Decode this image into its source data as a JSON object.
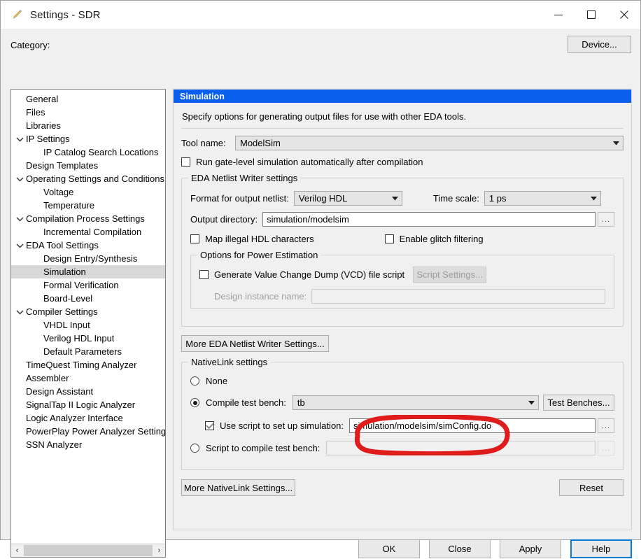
{
  "window": {
    "title": "Settings - SDR",
    "icon": "pencil-icon",
    "minimize": "minimize-icon",
    "maximize": "maximize-icon",
    "close": "close-icon"
  },
  "category": {
    "label": "Category:",
    "device_button": "Device...",
    "selected": "Simulation",
    "items": [
      {
        "label": "General",
        "indent": 0,
        "expander": ""
      },
      {
        "label": "Files",
        "indent": 0,
        "expander": ""
      },
      {
        "label": "Libraries",
        "indent": 0,
        "expander": ""
      },
      {
        "label": "IP Settings",
        "indent": 0,
        "expander": "down"
      },
      {
        "label": "IP Catalog Search Locations",
        "indent": 1,
        "expander": ""
      },
      {
        "label": "Design Templates",
        "indent": 0,
        "expander": ""
      },
      {
        "label": "Operating Settings and Conditions",
        "indent": 0,
        "expander": "down"
      },
      {
        "label": "Voltage",
        "indent": 1,
        "expander": ""
      },
      {
        "label": "Temperature",
        "indent": 1,
        "expander": ""
      },
      {
        "label": "Compilation Process Settings",
        "indent": 0,
        "expander": "down"
      },
      {
        "label": "Incremental Compilation",
        "indent": 1,
        "expander": ""
      },
      {
        "label": "EDA Tool Settings",
        "indent": 0,
        "expander": "down"
      },
      {
        "label": "Design Entry/Synthesis",
        "indent": 1,
        "expander": ""
      },
      {
        "label": "Simulation",
        "indent": 1,
        "expander": ""
      },
      {
        "label": "Formal Verification",
        "indent": 1,
        "expander": ""
      },
      {
        "label": "Board-Level",
        "indent": 1,
        "expander": ""
      },
      {
        "label": "Compiler Settings",
        "indent": 0,
        "expander": "down"
      },
      {
        "label": "VHDL Input",
        "indent": 1,
        "expander": ""
      },
      {
        "label": "Verilog HDL Input",
        "indent": 1,
        "expander": ""
      },
      {
        "label": "Default Parameters",
        "indent": 1,
        "expander": ""
      },
      {
        "label": "TimeQuest Timing Analyzer",
        "indent": 0,
        "expander": ""
      },
      {
        "label": "Assembler",
        "indent": 0,
        "expander": ""
      },
      {
        "label": "Design Assistant",
        "indent": 0,
        "expander": ""
      },
      {
        "label": "SignalTap II Logic Analyzer",
        "indent": 0,
        "expander": ""
      },
      {
        "label": "Logic Analyzer Interface",
        "indent": 0,
        "expander": ""
      },
      {
        "label": "PowerPlay Power Analyzer Settings",
        "indent": 0,
        "expander": ""
      },
      {
        "label": "SSN Analyzer",
        "indent": 0,
        "expander": ""
      }
    ],
    "scroll_left": "‹",
    "scroll_right": "›"
  },
  "panel": {
    "header": "Simulation",
    "description": "Specify options for generating output files for use with other EDA tools.",
    "tool_name_label": "Tool name:",
    "tool_name_value": "ModelSim",
    "run_gatelevel_label": "Run gate-level simulation automatically after compilation",
    "run_gatelevel_checked": false
  },
  "netlist_writer": {
    "title": "EDA Netlist Writer settings",
    "format_label": "Format for output netlist:",
    "format_value": "Verilog HDL",
    "timescale_label": "Time scale:",
    "timescale_value": "1 ps",
    "output_dir_label": "Output directory:",
    "output_dir_value": "simulation/modelsim",
    "browse_label": "...",
    "map_illegal_label": "Map illegal HDL characters",
    "map_illegal_checked": false,
    "glitch_label": "Enable glitch filtering",
    "glitch_checked": false,
    "power": {
      "title": "Options for Power Estimation",
      "vcd_label": "Generate Value Change Dump (VCD) file script",
      "vcd_checked": false,
      "script_settings_button": "Script Settings...",
      "design_instance_label": "Design instance name:",
      "design_instance_value": ""
    },
    "more_button": "More EDA Netlist Writer Settings..."
  },
  "nativelink": {
    "title": "NativeLink settings",
    "none_label": "None",
    "compile_tb_label": "Compile test bench:",
    "compile_tb_value": "tb",
    "test_benches_button": "Test Benches...",
    "use_script_label": "Use script to set up simulation:",
    "use_script_checked": true,
    "use_script_value": "simulation/modelsim/simConfig.do",
    "script_compile_label": "Script to compile test bench:",
    "script_compile_value": "",
    "selected_option": "compile_test_bench",
    "more_button": "More NativeLink Settings...",
    "reset_button": "Reset",
    "browse_label": "..."
  },
  "footer": {
    "ok": "OK",
    "close": "Close",
    "apply": "Apply",
    "help": "Help"
  },
  "annotation": {
    "type": "hand-drawn-ellipse",
    "color": "#e01b1b",
    "target": "use_script_value"
  }
}
